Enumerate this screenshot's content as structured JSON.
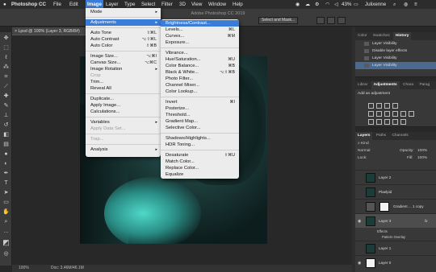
{
  "menubar": {
    "apple": "",
    "items": [
      "Photoshop CC",
      "File",
      "Edit",
      "Image",
      "Layer",
      "Type",
      "Select",
      "Filter",
      "3D",
      "View",
      "Window",
      "Help"
    ],
    "active": "Image",
    "battery": "43%",
    "user": "Julixenne"
  },
  "options": {
    "app_title": "Adobe Photoshop CC 2019",
    "select_mask": "Select and Mask..."
  },
  "document": {
    "tab": "Lpsd @ 100% (Layer 3, RGB/8#)",
    "status_zoom": "100%",
    "status_doc": "Doc: 3.46M/46.1M"
  },
  "image_menu": [
    {
      "label": "Mode",
      "arrow": "▸"
    },
    {
      "sep": true
    },
    {
      "label": "Adjustments",
      "arrow": "▸",
      "highlight": true
    },
    {
      "sep": true
    },
    {
      "label": "Auto Tone",
      "shortcut": "⇧⌘L"
    },
    {
      "label": "Auto Contrast",
      "shortcut": "⌥⇧⌘L"
    },
    {
      "label": "Auto Color",
      "shortcut": "⇧⌘B"
    },
    {
      "sep": true
    },
    {
      "label": "Image Size...",
      "shortcut": "⌥⌘I"
    },
    {
      "label": "Canvas Size...",
      "shortcut": "⌥⌘C"
    },
    {
      "label": "Image Rotation",
      "arrow": "▸"
    },
    {
      "label": "Crop",
      "disabled": true
    },
    {
      "label": "Trim..."
    },
    {
      "label": "Reveal All"
    },
    {
      "sep": true
    },
    {
      "label": "Duplicate..."
    },
    {
      "label": "Apply Image..."
    },
    {
      "label": "Calculations..."
    },
    {
      "sep": true
    },
    {
      "label": "Variables",
      "arrow": "▸"
    },
    {
      "label": "Apply Data Set...",
      "disabled": true
    },
    {
      "sep": true
    },
    {
      "label": "Trap...",
      "disabled": true
    },
    {
      "sep": true
    },
    {
      "label": "Analysis",
      "arrow": "▸"
    }
  ],
  "adjust_menu": [
    {
      "label": "Brightness/Contrast...",
      "highlight": true
    },
    {
      "label": "Levels...",
      "shortcut": "⌘L"
    },
    {
      "label": "Curves...",
      "shortcut": "⌘M"
    },
    {
      "label": "Exposure..."
    },
    {
      "sep": true
    },
    {
      "label": "Vibrance..."
    },
    {
      "label": "Hue/Saturation...",
      "shortcut": "⌘U"
    },
    {
      "label": "Color Balance...",
      "shortcut": "⌘B"
    },
    {
      "label": "Black & White...",
      "shortcut": "⌥⇧⌘B"
    },
    {
      "label": "Photo Filter..."
    },
    {
      "label": "Channel Mixer..."
    },
    {
      "label": "Color Lookup..."
    },
    {
      "sep": true
    },
    {
      "label": "Invert",
      "shortcut": "⌘I"
    },
    {
      "label": "Posterize..."
    },
    {
      "label": "Threshold..."
    },
    {
      "label": "Gradient Map..."
    },
    {
      "label": "Selective Color..."
    },
    {
      "sep": true
    },
    {
      "label": "Shadows/Highlights..."
    },
    {
      "label": "HDR Toning..."
    },
    {
      "sep": true
    },
    {
      "label": "Desaturate",
      "shortcut": "⇧⌘U"
    },
    {
      "label": "Match Color..."
    },
    {
      "label": "Replace Color..."
    },
    {
      "label": "Equalize"
    }
  ],
  "history_panel": {
    "tabs": [
      "Color",
      "Swatches",
      "History"
    ],
    "active_tab": "History",
    "rows": [
      "Layer Visibility",
      "Disable layer effects",
      "Layer Visibility",
      "Layer Visibility"
    ]
  },
  "adjust_panel": {
    "tabs": [
      "Librar",
      "Adjustments",
      "Chara",
      "Parag"
    ],
    "active_tab": "Adjustments",
    "title": "Add an adjustment"
  },
  "layers_panel": {
    "tabs": [
      "Layers",
      "Paths",
      "Channels"
    ],
    "active_tab": "Layers",
    "kind": "Kind",
    "blend": "Normal",
    "opacity_label": "Opacity:",
    "opacity": "100%",
    "lock_label": "Lock:",
    "fill_label": "Fill:",
    "fill": "100%",
    "layers": [
      {
        "name": "Layer 2",
        "thumb": "photo"
      },
      {
        "name": "Plaelpid",
        "thumb": "photo"
      },
      {
        "name": "Gradient ... 1 copy",
        "thumb": "white"
      },
      {
        "name": "Layer 3",
        "thumb": "photo",
        "selected": true,
        "fx": "fx"
      },
      {
        "name": "Layer 1",
        "thumb": "photo"
      },
      {
        "name": "Layer 0",
        "thumb": "white"
      }
    ],
    "effects_label": "Effects",
    "effect_item": "Pattern Overlay"
  }
}
